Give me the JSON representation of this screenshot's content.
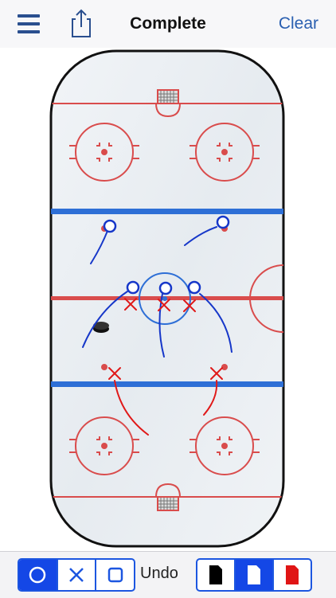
{
  "header": {
    "title": "Complete",
    "clear_label": "Clear",
    "menu_icon": "hamburger-menu-icon",
    "share_icon": "share-icon"
  },
  "toolbar": {
    "shape_tools": [
      {
        "name": "circle-tool",
        "icon": "circle-icon",
        "selected": true
      },
      {
        "name": "x-tool",
        "icon": "x-icon",
        "selected": false
      },
      {
        "name": "square-tool",
        "icon": "square-icon",
        "selected": false
      }
    ],
    "undo_label": "Undo",
    "color_tools": [
      {
        "name": "black-color",
        "color": "#000000",
        "selected": false
      },
      {
        "name": "blue-color",
        "color": "#1447e6",
        "selected": true
      },
      {
        "name": "red-color",
        "color": "#e01515",
        "selected": false
      }
    ]
  },
  "colors": {
    "accent_blue": "#1c56e0",
    "rink_red": "#d94c4c",
    "rink_blue": "#2e6fd6",
    "drawing_blue": "#1637c9",
    "drawing_red": "#e01818"
  }
}
